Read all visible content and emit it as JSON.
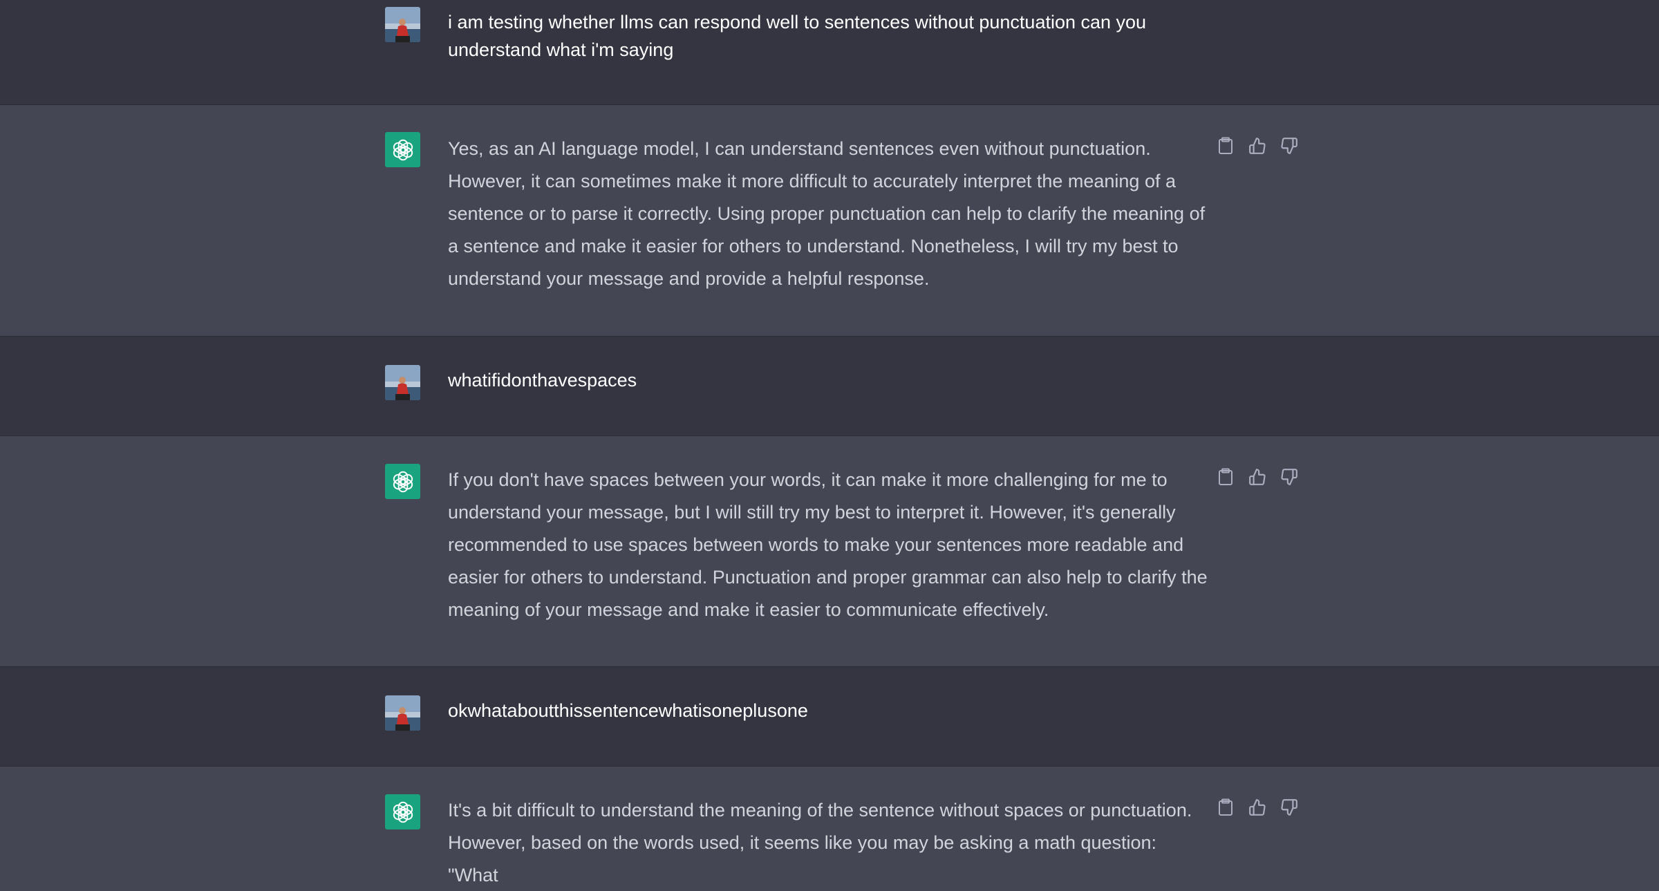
{
  "conversation": [
    {
      "role": "user",
      "text": "i am testing whether llms can respond well to sentences without punctuation can you\nunderstand what i'm saying"
    },
    {
      "role": "assistant",
      "text": "Yes, as an AI language model, I can understand sentences even without punctuation.\nHowever, it can sometimes make it more difficult to accurately interpret the meaning of a\nsentence or to parse it correctly. Using proper punctuation can help to clarify the meaning of\na sentence and make it easier for others to understand. Nonetheless, I will try my best to\nunderstand your message and provide a helpful response."
    },
    {
      "role": "user",
      "text": "whatifidonthavespaces"
    },
    {
      "role": "assistant",
      "text": "If you don't have spaces between your words, it can make it more challenging for me to\nunderstand your message, but I will still try my best to interpret it. However, it's generally\nrecommended to use spaces between words to make your sentences more readable and\neasier for others to understand. Punctuation and proper grammar can also help to clarify the\nmeaning of your message and make it easier to communicate effectively."
    },
    {
      "role": "user",
      "text": "okwhataboutthissentencewhatisoneplusone"
    },
    {
      "role": "assistant",
      "text": "It's a bit difficult to understand the meaning of the sentence without spaces or punctuation.\nHowever, based on the words used, it seems like you may be asking a math question: \"What\nis one plus one?\" The answer to this question is two."
    }
  ],
  "icons": {
    "user_avatar": "user-photo-avatar",
    "assistant_avatar": "openai-logo-icon",
    "copy": "clipboard-icon",
    "like": "thumbs-up-icon",
    "dislike": "thumbs-down-icon"
  },
  "colors": {
    "user_row_bg": "#343541",
    "assistant_row_bg": "#444654",
    "assistant_avatar_bg": "#19a37f",
    "text_primary": "#ececf1",
    "icon_color": "#acacbe"
  }
}
